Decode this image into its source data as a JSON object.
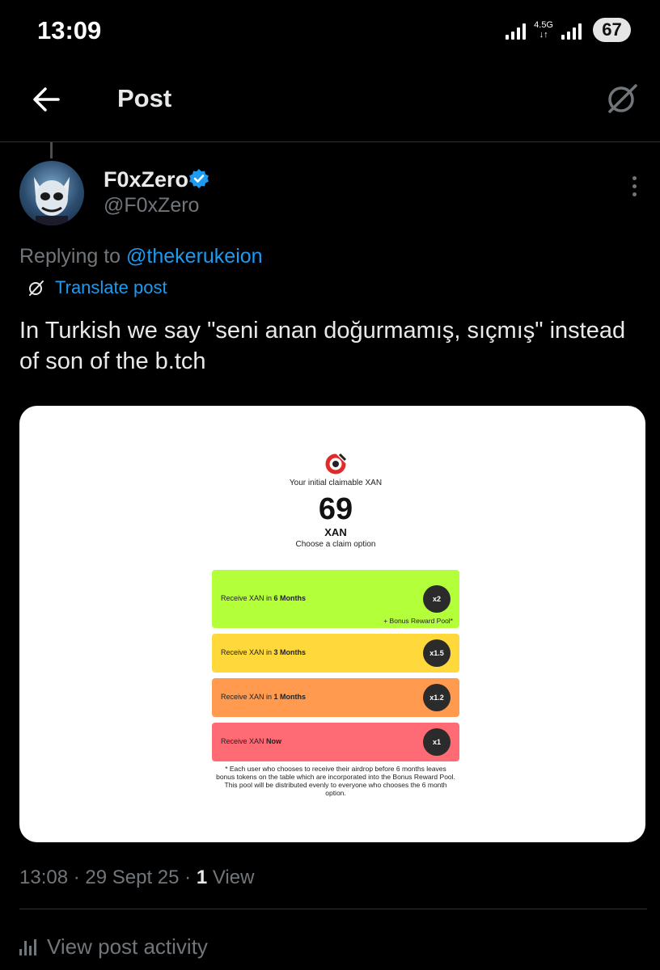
{
  "status_bar": {
    "time": "13:09",
    "network_type": "4.5G",
    "battery": "67"
  },
  "header": {
    "title": "Post"
  },
  "post": {
    "author": {
      "display_name": "F0xZero",
      "handle": "@F0xZero",
      "verified": true
    },
    "replying_prefix": "Replying to ",
    "replying_to": "@thekerukeion",
    "translate_label": "Translate post",
    "text": "In Turkish we say \"seni anan doğurmamış, sıçmış\" instead of son of the b.tch",
    "media": {
      "caption": "Your initial claimable XAN",
      "amount": "69",
      "unit": "XAN",
      "choose": "Choose a claim option",
      "options": [
        {
          "label_prefix": "Receive XAN in ",
          "label_bold": "6 Months",
          "multiplier": "x2",
          "note": "+ Bonus Reward Pool*",
          "color": "#b2ff3a"
        },
        {
          "label_prefix": "Receive XAN in ",
          "label_bold": "3 Months",
          "multiplier": "x1.5",
          "note": "",
          "color": "#ffd83b"
        },
        {
          "label_prefix": "Receive XAN in ",
          "label_bold": "1 Months",
          "multiplier": "x1.2",
          "note": "",
          "color": "#ff9a4f"
        },
        {
          "label_prefix": "Receive XAN ",
          "label_bold": "Now",
          "multiplier": "x1",
          "note": "",
          "color": "#ff6b74"
        }
      ],
      "footnote": "* Each user who chooses to receive their airdrop before 6 months leaves bonus tokens on the table which are incorporated into the Bonus Reward Pool. This pool will be distributed evenly to everyone who chooses the 6 month option."
    },
    "meta": {
      "time": "13:08",
      "date": "29 Sept 25",
      "views_count": "1",
      "views_label": "View"
    },
    "activity_label": "View post activity"
  },
  "colors": {
    "accent": "#1d9bf0",
    "muted": "#71767b",
    "background": "#000000"
  }
}
